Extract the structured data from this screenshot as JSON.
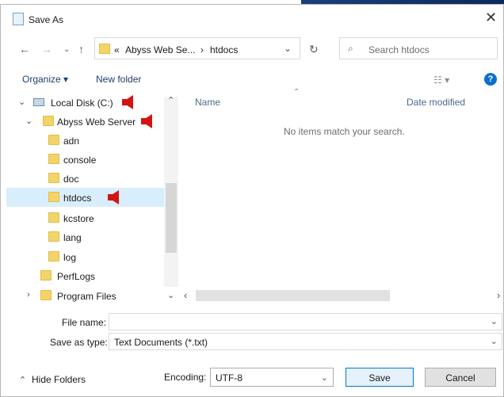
{
  "window": {
    "title": "Save As"
  },
  "address": {
    "crumbs": [
      "«",
      "Abyss Web Se...",
      "›",
      "htdocs"
    ]
  },
  "search": {
    "placeholder": "Search htdocs"
  },
  "toolbar": {
    "organize": "Organize ▾",
    "new_folder": "New folder"
  },
  "columns": {
    "name": "Name",
    "date_modified": "Date modified"
  },
  "content": {
    "empty_message": "No items match your search."
  },
  "tree": [
    {
      "label": "Local Disk (C:)",
      "type": "drive"
    },
    {
      "label": "Abyss Web Server",
      "type": "folder"
    },
    {
      "label": "adn",
      "type": "folder"
    },
    {
      "label": "console",
      "type": "folder"
    },
    {
      "label": "doc",
      "type": "folder"
    },
    {
      "label": "htdocs",
      "type": "folder",
      "selected": true
    },
    {
      "label": "kcstore",
      "type": "folder"
    },
    {
      "label": "lang",
      "type": "folder"
    },
    {
      "label": "log",
      "type": "folder"
    },
    {
      "label": "PerfLogs",
      "type": "folder"
    },
    {
      "label": "Program Files",
      "type": "folder"
    }
  ],
  "fields": {
    "file_name_label": "File name:",
    "file_name_value": "",
    "save_as_type_label": "Save as type:",
    "save_as_type_value": "Text Documents (*.txt)"
  },
  "footer": {
    "hide_folders": "Hide Folders",
    "encoding_label": "Encoding:",
    "encoding_value": "UTF-8",
    "save": "Save",
    "cancel": "Cancel"
  },
  "colors": {
    "accent": "#0078d7",
    "annotation_arrow": "#d41313",
    "selection": "#d9eefc",
    "folder": "#f3d46a"
  }
}
